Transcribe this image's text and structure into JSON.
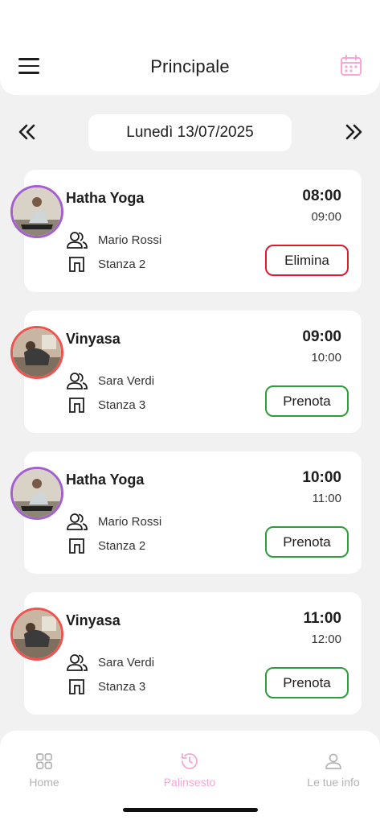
{
  "header": {
    "title": "Principale"
  },
  "date_nav": {
    "date_label": "Lunedì 13/07/2025"
  },
  "classes": [
    {
      "name": "Hatha Yoga",
      "start": "08:00",
      "end": "09:00",
      "teacher": "Mario Rossi",
      "room": "Stanza 2",
      "action": "Elimina",
      "avatar_ring_color": "#a35fd0",
      "action_color": "#e0192c"
    },
    {
      "name": "Vinyasa",
      "start": "09:00",
      "end": "10:00",
      "teacher": "Sara Verdi",
      "room": "Stanza 3",
      "action": "Prenota",
      "avatar_ring_color": "#ef5350",
      "action_color": "#2e9d3a"
    },
    {
      "name": "Hatha Yoga",
      "start": "10:00",
      "end": "11:00",
      "teacher": "Mario Rossi",
      "room": "Stanza 2",
      "action": "Prenota",
      "avatar_ring_color": "#a35fd0",
      "action_color": "#2e9d3a"
    },
    {
      "name": "Vinyasa",
      "start": "11:00",
      "end": "12:00",
      "teacher": "Sara Verdi",
      "room": "Stanza 3",
      "action": "Prenota",
      "avatar_ring_color": "#ef5350",
      "action_color": "#2e9d3a"
    }
  ],
  "bottom_nav": {
    "items": [
      {
        "label": "Home",
        "icon": "grid-icon"
      },
      {
        "label": "Palinsesto",
        "icon": "schedule-icon"
      },
      {
        "label": "Le tue info",
        "icon": "user-icon"
      }
    ],
    "active_color": "#f7a6d6",
    "inactive_color": "#b3b3b3"
  },
  "colors": {
    "accent": "#f7a6d6",
    "background": "#f2f1f2"
  }
}
